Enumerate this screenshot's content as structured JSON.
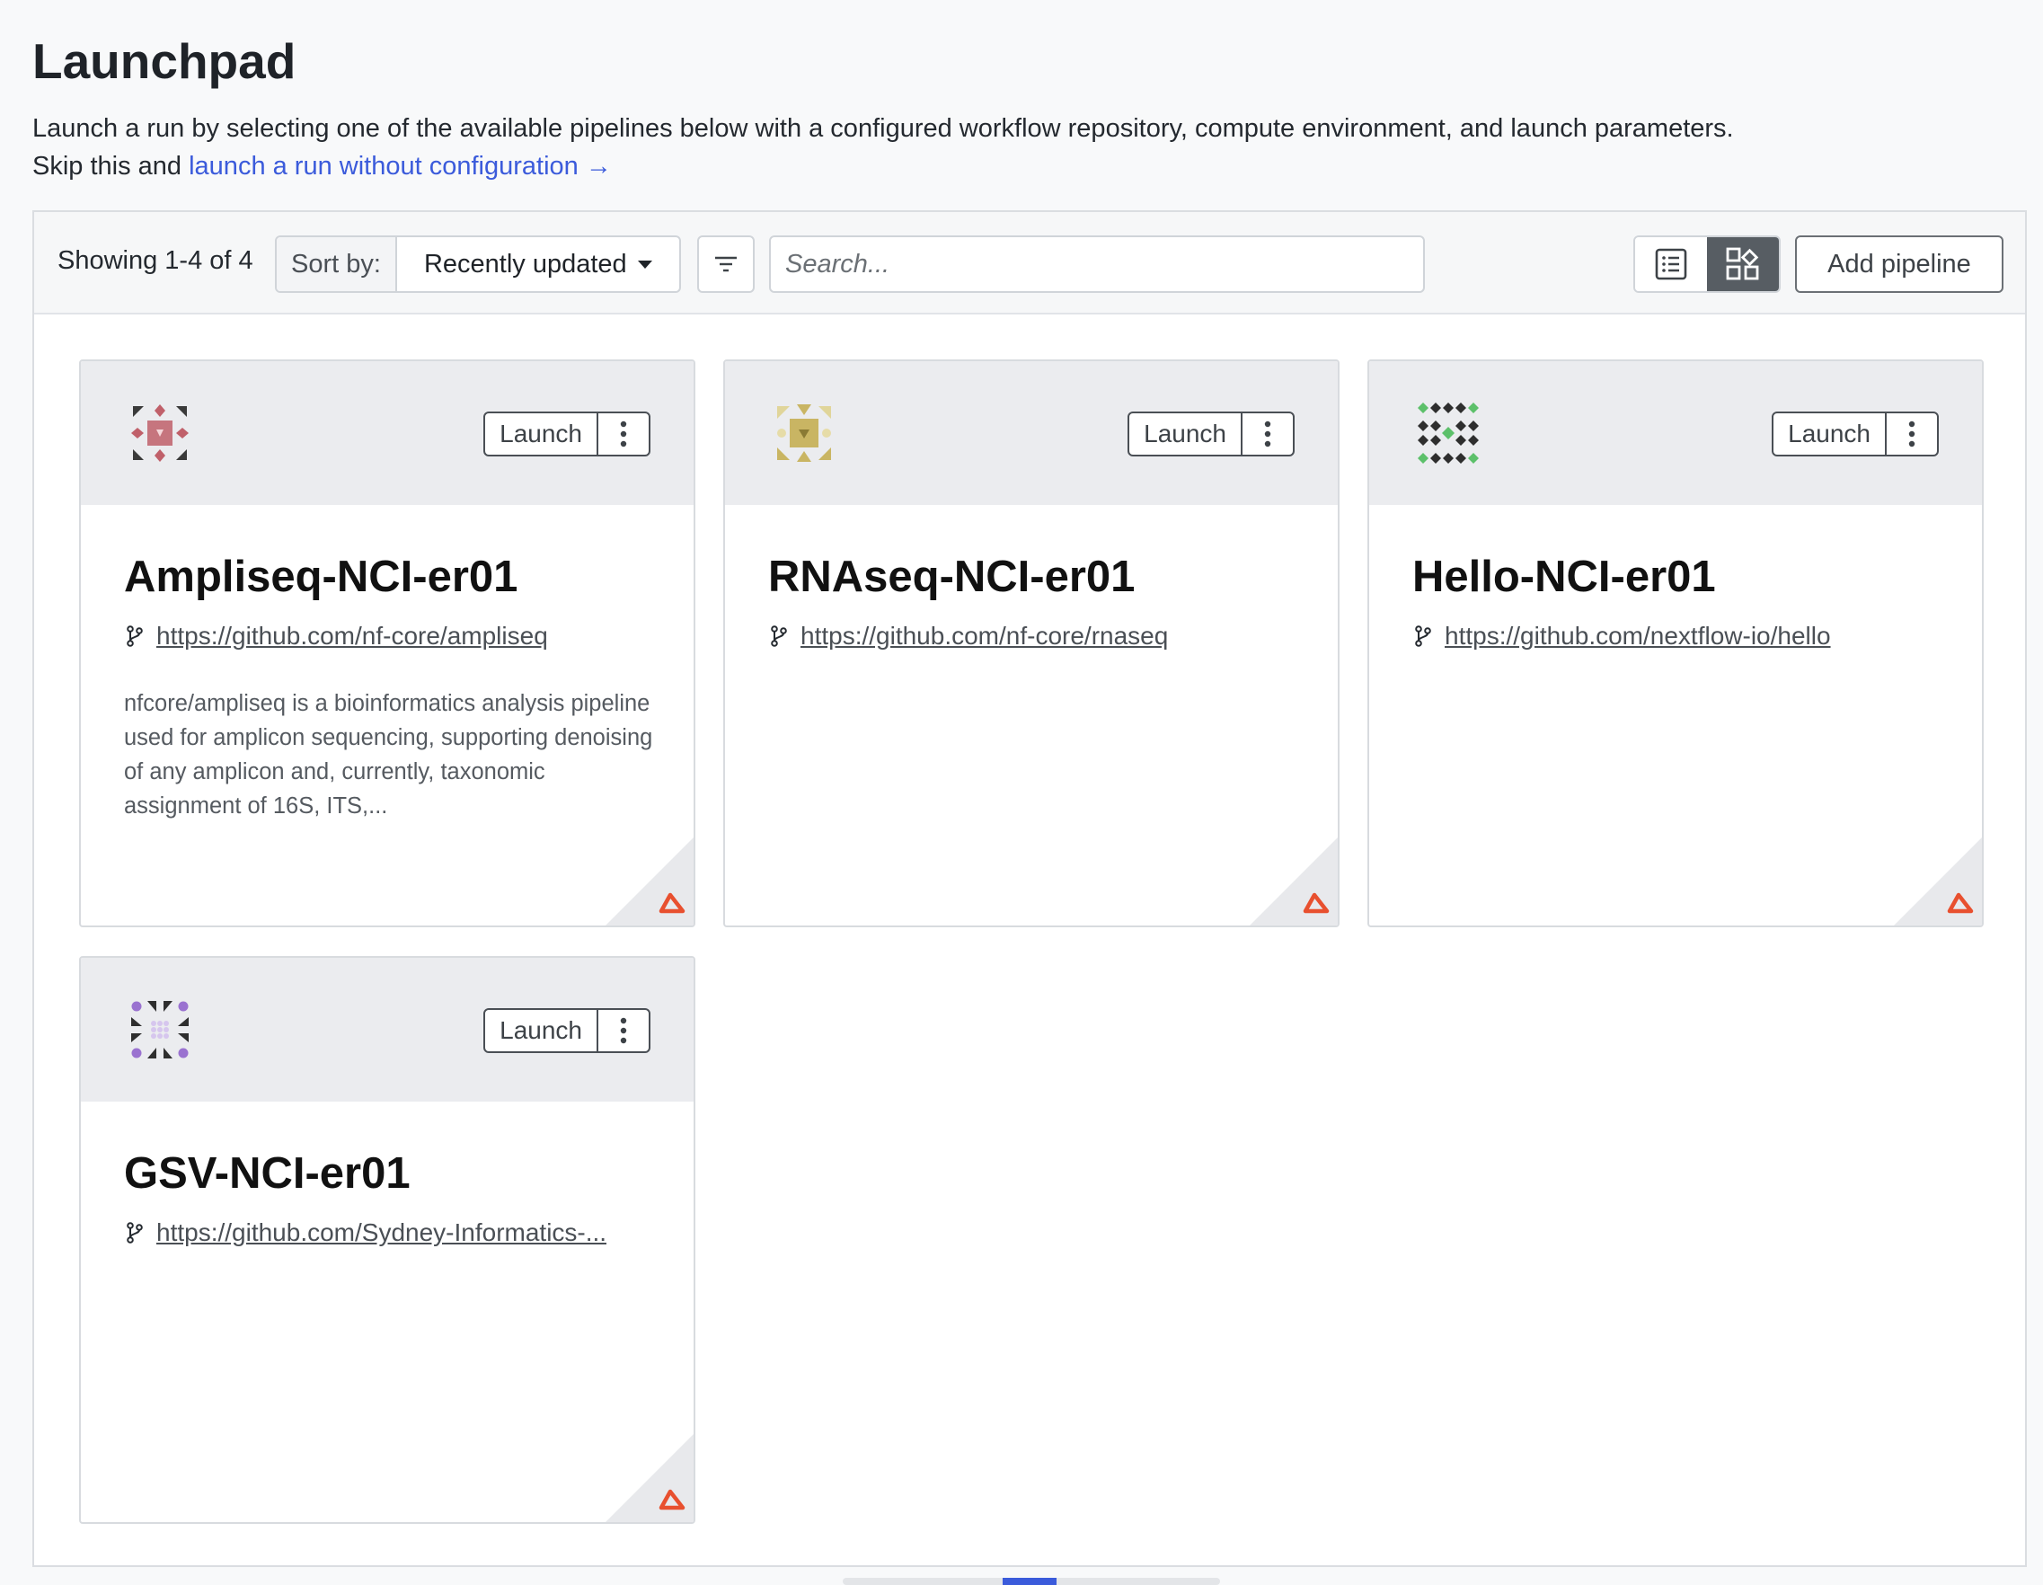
{
  "page": {
    "title": "Launchpad",
    "description": "Launch a run by selecting one of the available pipelines below with a configured workflow repository, compute environment, and launch parameters.",
    "skip_prefix": "Skip this and ",
    "skip_link": "launch a run without configuration",
    "skip_arrow": "→"
  },
  "toolbar": {
    "showing": "Showing 1-4 of 4",
    "sort_label": "Sort by:",
    "sort_value": "Recently updated",
    "search_placeholder": "Search...",
    "add_pipeline": "Add pipeline"
  },
  "cards": [
    {
      "title": "Ampliseq-NCI-er01",
      "repo": "https://github.com/nf-core/ampliseq",
      "description": "nfcore/ampliseq is a bioinformatics analysis pipeline used for amplicon sequencing, supporting denoising of any amplicon and, currently, taxonomic assignment of 16S, ITS,...",
      "launch": "Launch",
      "logo_color": "#c0606a"
    },
    {
      "title": "RNAseq-NCI-er01",
      "repo": "https://github.com/nf-core/rnaseq",
      "description": "",
      "launch": "Launch",
      "logo_color": "#c9b563"
    },
    {
      "title": "Hello-NCI-er01",
      "repo": "https://github.com/nextflow-io/hello",
      "description": "",
      "launch": "Launch",
      "logo_color": "#5cc06a"
    },
    {
      "title": "GSV-NCI-er01",
      "repo": "https://github.com/Sydney-Informatics-...",
      "description": "",
      "launch": "Launch",
      "logo_color": "#9a72d0"
    }
  ],
  "colors": {
    "link": "#3b5bdb",
    "nextflow_icon": "#e8502f",
    "active_view": "#575d63"
  },
  "icons": {
    "filter": "filter-icon",
    "list_view": "list-view-icon",
    "grid_view": "grid-view-icon",
    "kebab": "more-vertical-icon",
    "branch": "git-branch-icon",
    "platform": "nextflow-logo-icon"
  }
}
